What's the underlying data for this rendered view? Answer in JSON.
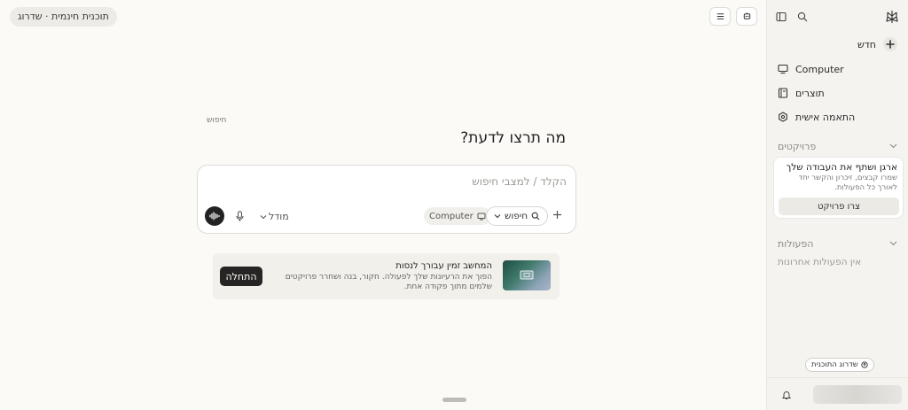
{
  "header": {
    "plan_label": "תוכנית חינמית · שדרוג"
  },
  "main": {
    "search_hint": "חיפוש",
    "heading": "מה תרצו לדעת?",
    "composer": {
      "placeholder": "הקלד / למצבי חיפוש",
      "model_label": "מודל",
      "computer_chip": "Computer",
      "search_chip": "חיפוש"
    },
    "promo": {
      "title": "המחשב זמין עבורך לנסות",
      "description": "הפוך את הרעיונות שלך לפעולה. חקור, בנה ושחרר פרויקטים שלמים מתוך פקודה אחת.",
      "start_button": "התחלה"
    }
  },
  "sidebar": {
    "new_label": "חדש",
    "items": [
      {
        "label": "Computer",
        "icon": "monitor-icon"
      },
      {
        "label": "תוצרים",
        "icon": "book-icon"
      },
      {
        "label": "התאמה אישית",
        "icon": "settings-icon"
      }
    ],
    "projects_section": "פרויקטים",
    "project_card": {
      "title": "ארגן ושתף את העבודה שלך",
      "description": "שמרו קבצים, זיכרון והקשר יחד לאורך כל הפעולות.",
      "button": "צרו פרויקט"
    },
    "actions_section": "הפעולות",
    "no_actions": "אין הפעולות אחרונות",
    "upgrade_label": "שדרוג התוכנית"
  }
}
